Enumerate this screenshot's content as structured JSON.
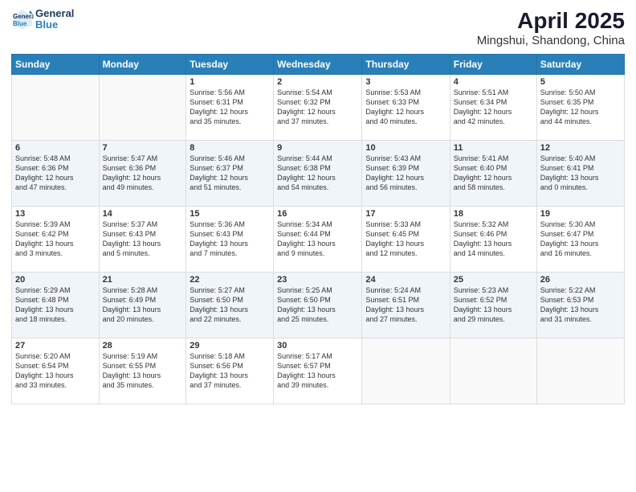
{
  "header": {
    "logo_line1": "General",
    "logo_line2": "Blue",
    "month": "April 2025",
    "location": "Mingshui, Shandong, China"
  },
  "weekdays": [
    "Sunday",
    "Monday",
    "Tuesday",
    "Wednesday",
    "Thursday",
    "Friday",
    "Saturday"
  ],
  "weeks": [
    [
      {
        "day": "",
        "info": ""
      },
      {
        "day": "",
        "info": ""
      },
      {
        "day": "1",
        "info": "Sunrise: 5:56 AM\nSunset: 6:31 PM\nDaylight: 12 hours\nand 35 minutes."
      },
      {
        "day": "2",
        "info": "Sunrise: 5:54 AM\nSunset: 6:32 PM\nDaylight: 12 hours\nand 37 minutes."
      },
      {
        "day": "3",
        "info": "Sunrise: 5:53 AM\nSunset: 6:33 PM\nDaylight: 12 hours\nand 40 minutes."
      },
      {
        "day": "4",
        "info": "Sunrise: 5:51 AM\nSunset: 6:34 PM\nDaylight: 12 hours\nand 42 minutes."
      },
      {
        "day": "5",
        "info": "Sunrise: 5:50 AM\nSunset: 6:35 PM\nDaylight: 12 hours\nand 44 minutes."
      }
    ],
    [
      {
        "day": "6",
        "info": "Sunrise: 5:48 AM\nSunset: 6:36 PM\nDaylight: 12 hours\nand 47 minutes."
      },
      {
        "day": "7",
        "info": "Sunrise: 5:47 AM\nSunset: 6:36 PM\nDaylight: 12 hours\nand 49 minutes."
      },
      {
        "day": "8",
        "info": "Sunrise: 5:46 AM\nSunset: 6:37 PM\nDaylight: 12 hours\nand 51 minutes."
      },
      {
        "day": "9",
        "info": "Sunrise: 5:44 AM\nSunset: 6:38 PM\nDaylight: 12 hours\nand 54 minutes."
      },
      {
        "day": "10",
        "info": "Sunrise: 5:43 AM\nSunset: 6:39 PM\nDaylight: 12 hours\nand 56 minutes."
      },
      {
        "day": "11",
        "info": "Sunrise: 5:41 AM\nSunset: 6:40 PM\nDaylight: 12 hours\nand 58 minutes."
      },
      {
        "day": "12",
        "info": "Sunrise: 5:40 AM\nSunset: 6:41 PM\nDaylight: 13 hours\nand 0 minutes."
      }
    ],
    [
      {
        "day": "13",
        "info": "Sunrise: 5:39 AM\nSunset: 6:42 PM\nDaylight: 13 hours\nand 3 minutes."
      },
      {
        "day": "14",
        "info": "Sunrise: 5:37 AM\nSunset: 6:43 PM\nDaylight: 13 hours\nand 5 minutes."
      },
      {
        "day": "15",
        "info": "Sunrise: 5:36 AM\nSunset: 6:43 PM\nDaylight: 13 hours\nand 7 minutes."
      },
      {
        "day": "16",
        "info": "Sunrise: 5:34 AM\nSunset: 6:44 PM\nDaylight: 13 hours\nand 9 minutes."
      },
      {
        "day": "17",
        "info": "Sunrise: 5:33 AM\nSunset: 6:45 PM\nDaylight: 13 hours\nand 12 minutes."
      },
      {
        "day": "18",
        "info": "Sunrise: 5:32 AM\nSunset: 6:46 PM\nDaylight: 13 hours\nand 14 minutes."
      },
      {
        "day": "19",
        "info": "Sunrise: 5:30 AM\nSunset: 6:47 PM\nDaylight: 13 hours\nand 16 minutes."
      }
    ],
    [
      {
        "day": "20",
        "info": "Sunrise: 5:29 AM\nSunset: 6:48 PM\nDaylight: 13 hours\nand 18 minutes."
      },
      {
        "day": "21",
        "info": "Sunrise: 5:28 AM\nSunset: 6:49 PM\nDaylight: 13 hours\nand 20 minutes."
      },
      {
        "day": "22",
        "info": "Sunrise: 5:27 AM\nSunset: 6:50 PM\nDaylight: 13 hours\nand 22 minutes."
      },
      {
        "day": "23",
        "info": "Sunrise: 5:25 AM\nSunset: 6:50 PM\nDaylight: 13 hours\nand 25 minutes."
      },
      {
        "day": "24",
        "info": "Sunrise: 5:24 AM\nSunset: 6:51 PM\nDaylight: 13 hours\nand 27 minutes."
      },
      {
        "day": "25",
        "info": "Sunrise: 5:23 AM\nSunset: 6:52 PM\nDaylight: 13 hours\nand 29 minutes."
      },
      {
        "day": "26",
        "info": "Sunrise: 5:22 AM\nSunset: 6:53 PM\nDaylight: 13 hours\nand 31 minutes."
      }
    ],
    [
      {
        "day": "27",
        "info": "Sunrise: 5:20 AM\nSunset: 6:54 PM\nDaylight: 13 hours\nand 33 minutes."
      },
      {
        "day": "28",
        "info": "Sunrise: 5:19 AM\nSunset: 6:55 PM\nDaylight: 13 hours\nand 35 minutes."
      },
      {
        "day": "29",
        "info": "Sunrise: 5:18 AM\nSunset: 6:56 PM\nDaylight: 13 hours\nand 37 minutes."
      },
      {
        "day": "30",
        "info": "Sunrise: 5:17 AM\nSunset: 6:57 PM\nDaylight: 13 hours\nand 39 minutes."
      },
      {
        "day": "",
        "info": ""
      },
      {
        "day": "",
        "info": ""
      },
      {
        "day": "",
        "info": ""
      }
    ]
  ]
}
